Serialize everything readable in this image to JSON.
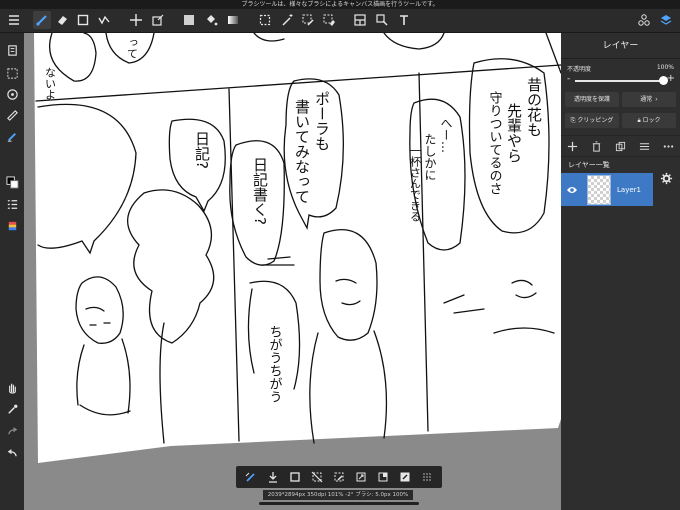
{
  "status": {
    "message": "ブラシツールは、様々なブラシによるキャンバス描画を行うツールです。"
  },
  "panel": {
    "title": "レイヤー",
    "opacity_label": "不透明度",
    "opacity_value": "100%",
    "opacity_level": 1.0,
    "protect_button": "透明度を保護",
    "blend_button": "通常",
    "clipping_button": "クリッピング",
    "lock_button": "ロック",
    "layer_list_label": "レイヤー一覧",
    "layers": [
      {
        "name": "Layer1",
        "visible": true,
        "selected": true
      }
    ]
  },
  "info": {
    "text": "2039*2894px 350dpi 101% -2° ブラシ: 5.0px 100%"
  },
  "colors": {
    "accent": "#3d79c5",
    "toolbar": "#2b2b2b",
    "panel": "#2e2e2e"
  },
  "canvas": {
    "texts": [
      {
        "id": "t1",
        "text": "ないよ"
      },
      {
        "id": "t2",
        "text": "って"
      },
      {
        "id": "t3",
        "text": "昔の花も"
      },
      {
        "id": "t4",
        "text": "先輩やら"
      },
      {
        "id": "t5",
        "text": "守りついてるのさ"
      },
      {
        "id": "t6",
        "text": "ポーラも"
      },
      {
        "id": "t7",
        "text": "書いてみなって"
      },
      {
        "id": "t8",
        "text": "日記?"
      },
      {
        "id": "t9",
        "text": "日記書く?"
      },
      {
        "id": "t10",
        "text": "へー…"
      },
      {
        "id": "t11",
        "text": "たしかに"
      },
      {
        "id": "t12",
        "text": "一杯さんできる"
      },
      {
        "id": "t13",
        "text": "ちがうちがう"
      }
    ]
  }
}
